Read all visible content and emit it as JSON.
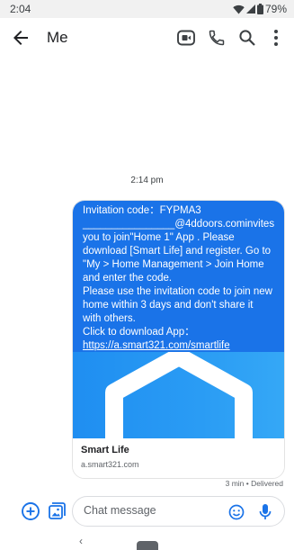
{
  "status_bar": {
    "time": "2:04",
    "battery": "79%"
  },
  "app_bar": {
    "title": "Me",
    "icons": [
      "back-arrow-icon",
      "video-call-icon",
      "phone-icon",
      "search-icon",
      "more-vert-icon"
    ]
  },
  "conversation": {
    "timestamp": "2:14 pm",
    "message": {
      "line1": "Invitation code：FYPMA3",
      "line2": "________________@4ddoors.cominvites you to join\"Home 1\" App . Please download [Smart Life] and register. Go to \"My > Home Management > Join Home and enter the code.",
      "line3": "Please use the invitation code to join new home within 3 days and don't share it with others.",
      "line4": "Click to download App：",
      "link": "https://a.smart321.com/smartlife"
    },
    "link_preview": {
      "title": "Smart Life",
      "domain": "a.smart321.com"
    },
    "delivery_status": "3 min • Delivered"
  },
  "compose": {
    "placeholder": "Chat message",
    "icons": [
      "add-circle-icon",
      "gallery-icon",
      "emoji-icon",
      "mic-icon"
    ]
  },
  "nav_bar": {
    "back_glyph": "‹"
  },
  "colors": {
    "accent": "#1a73e8",
    "bubble_text": "#ffffff",
    "preview_blue": "#2a9cf4"
  }
}
